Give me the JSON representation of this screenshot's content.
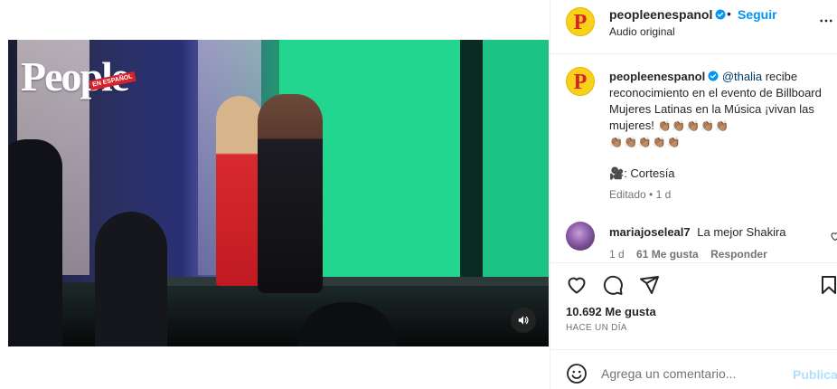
{
  "video": {
    "brand_logo_text": "People",
    "brand_logo_tag": "EN ESPAÑOL",
    "mute_icon": "speaker-icon"
  },
  "post": {
    "author": "peopleenespanol",
    "separator": "•",
    "follow_label": "Seguir",
    "audio_label": "Audio original",
    "avatar_letter": "P",
    "more_icon": "more-options-icon"
  },
  "caption": {
    "username": "peopleenespanol",
    "mention": "@thalia",
    "text": " recibe reconocimiento en el evento de Billboard Mujeres Latinas en la Música ¡vivan las mujeres! ",
    "emojis_line1": "👏🏽👏🏽👏🏽👏🏽👏🏽",
    "emojis_line2": "👏🏽👏🏽👏🏽👏🏽👏🏽",
    "credit_icon": "🎥",
    "credit_text": ": Cortesía",
    "edited_label": "Editado",
    "edited_separator": "•",
    "edited_time": "1 d"
  },
  "comment": {
    "username": "mariajoseleal7",
    "text": "La mejor Shakira",
    "time": "1 d",
    "likes": "61 Me gusta",
    "reply_label": "Responder"
  },
  "actions": {
    "like_icon": "heart-icon",
    "comment_icon": "comment-icon",
    "share_icon": "send-icon",
    "save_icon": "bookmark-icon",
    "likes_count": "10.692 Me gusta",
    "time_ago": "HACE UN DÍA"
  },
  "composer": {
    "emoji_icon": "emoji-icon",
    "placeholder": "Agrega un comentario...",
    "publish_label": "Publicar"
  },
  "colors": {
    "accent": "#0095f6",
    "publish_disabled": "#b2dffc",
    "brand_yellow": "#f9d11b",
    "brand_red": "#d8222b"
  }
}
